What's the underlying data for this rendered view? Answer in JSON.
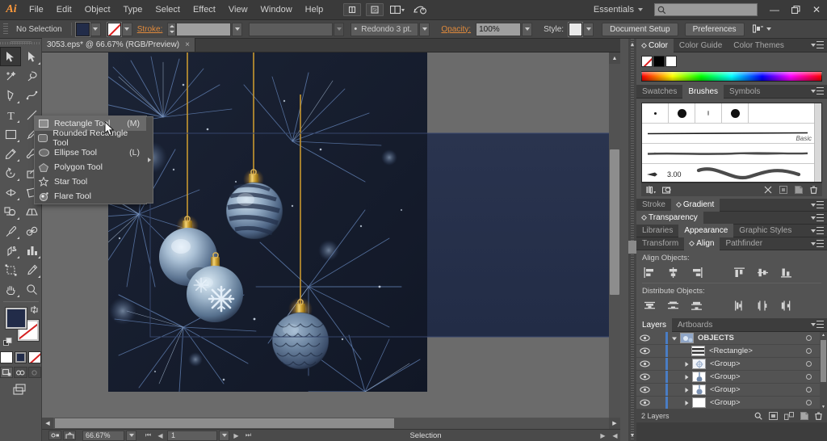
{
  "app": {
    "name": "Adobe Illustrator",
    "logo": "Ai"
  },
  "menubar": {
    "items": [
      "File",
      "Edit",
      "Object",
      "Type",
      "Select",
      "Effect",
      "View",
      "Window",
      "Help"
    ],
    "workspace": "Essentials",
    "search_placeholder": "",
    "window_buttons": {
      "minimize": "—",
      "restore": "❐",
      "close": "✕"
    }
  },
  "controlbar": {
    "selection_status": "No Selection",
    "fill_color": "#222c49",
    "stroke_color": "none",
    "stroke_label": "Stroke:",
    "stroke_weight": "",
    "profile": "",
    "brush_definition": "Redondo 3 pt.",
    "opacity_label": "Opacity:",
    "opacity_value": "100%",
    "style_label": "Style:",
    "document_setup": "Document Setup",
    "preferences": "Preferences"
  },
  "document": {
    "tab_title": "3053.eps* @ 66.67% (RGB/Preview)",
    "close_glyph": "×"
  },
  "toolbar": {
    "tools": [
      "selection-tool",
      "direct-selection-tool",
      "magic-wand-tool",
      "lasso-tool",
      "pen-tool",
      "curvature-tool",
      "type-tool",
      "line-segment-tool",
      "rectangle-tool",
      "paintbrush-tool",
      "pencil-tool",
      "blob-brush-tool",
      "rotate-tool",
      "scale-tool",
      "width-tool",
      "free-transform-tool",
      "shape-builder-tool",
      "perspective-grid-tool",
      "mesh-tool",
      "gradient-tool",
      "eyedropper-tool",
      "blend-tool",
      "symbol-sprayer-tool",
      "column-graph-tool",
      "artboard-tool",
      "slice-tool",
      "hand-tool",
      "zoom-tool"
    ],
    "fill_color": "#222c49",
    "stroke_color": "#ffffff",
    "color_modes": [
      "color",
      "gradient",
      "none"
    ],
    "screen_modes": [
      "normal-screen-mode",
      "full-screen-menu-bar",
      "full-screen"
    ]
  },
  "flyout": {
    "items": [
      {
        "icon": "rectangle-icon",
        "label": "Rectangle Tool",
        "shortcut": "(M)",
        "highlighted": true
      },
      {
        "icon": "rounded-rectangle-icon",
        "label": "Rounded Rectangle Tool",
        "shortcut": ""
      },
      {
        "icon": "ellipse-icon",
        "label": "Ellipse Tool",
        "shortcut": "(L)"
      },
      {
        "icon": "polygon-icon",
        "label": "Polygon Tool",
        "shortcut": ""
      },
      {
        "icon": "star-icon",
        "label": "Star Tool",
        "shortcut": ""
      },
      {
        "icon": "flare-icon",
        "label": "Flare Tool",
        "shortcut": ""
      }
    ]
  },
  "canvas": {
    "artwork_description": "Christmas ornaments hanging on a dark blue pine tree",
    "background": "#6b6b6b",
    "artboard_fill": "#26304f"
  },
  "statusbar": {
    "zoom": "66.67%",
    "page": "1",
    "status_text": "Selection"
  },
  "panels": {
    "color": {
      "tabs": [
        "Color",
        "Color Guide",
        "Color Themes"
      ],
      "active_tab": "Color",
      "swatches": [
        "none",
        "black",
        "white"
      ]
    },
    "brushes": {
      "tabs": [
        "Swatches",
        "Brushes",
        "Symbols"
      ],
      "active_tab": "Brushes",
      "basic_label": "Basic",
      "stroke_size": "3.00"
    },
    "stroke_gradient": {
      "tabs": [
        "Stroke",
        "Gradient"
      ],
      "active_tab": "Gradient"
    },
    "transparency": {
      "title": "Transparency"
    },
    "appearance": {
      "tabs": [
        "Libraries",
        "Appearance",
        "Graphic Styles"
      ],
      "active_tab": "Appearance"
    },
    "align": {
      "tabs": [
        "Transform",
        "Align",
        "Pathfinder"
      ],
      "active_tab": "Align",
      "align_objects_label": "Align Objects:",
      "distribute_objects_label": "Distribute Objects:",
      "align_buttons": [
        "align-left",
        "align-horizontal-center",
        "align-right",
        "align-top",
        "align-vertical-center",
        "align-bottom"
      ],
      "distribute_buttons": [
        "distribute-top",
        "distribute-vertical-center",
        "distribute-bottom",
        "distribute-left",
        "distribute-horizontal-center",
        "distribute-right"
      ]
    },
    "layers": {
      "tabs": [
        "Layers",
        "Artboards"
      ],
      "active_tab": "Layers",
      "rows": [
        {
          "name": "OBJECTS",
          "type": "layer",
          "expanded": true,
          "indent": 0,
          "bold": true
        },
        {
          "name": "<Rectangle>",
          "type": "object",
          "expanded": false,
          "indent": 1
        },
        {
          "name": "<Group>",
          "type": "group",
          "expanded": false,
          "indent": 1
        },
        {
          "name": "<Group>",
          "type": "group",
          "expanded": false,
          "indent": 1
        },
        {
          "name": "<Group>",
          "type": "group",
          "expanded": false,
          "indent": 1
        },
        {
          "name": "<Group>",
          "type": "group",
          "expanded": false,
          "indent": 1
        }
      ],
      "footer_count": "2 Layers"
    }
  }
}
